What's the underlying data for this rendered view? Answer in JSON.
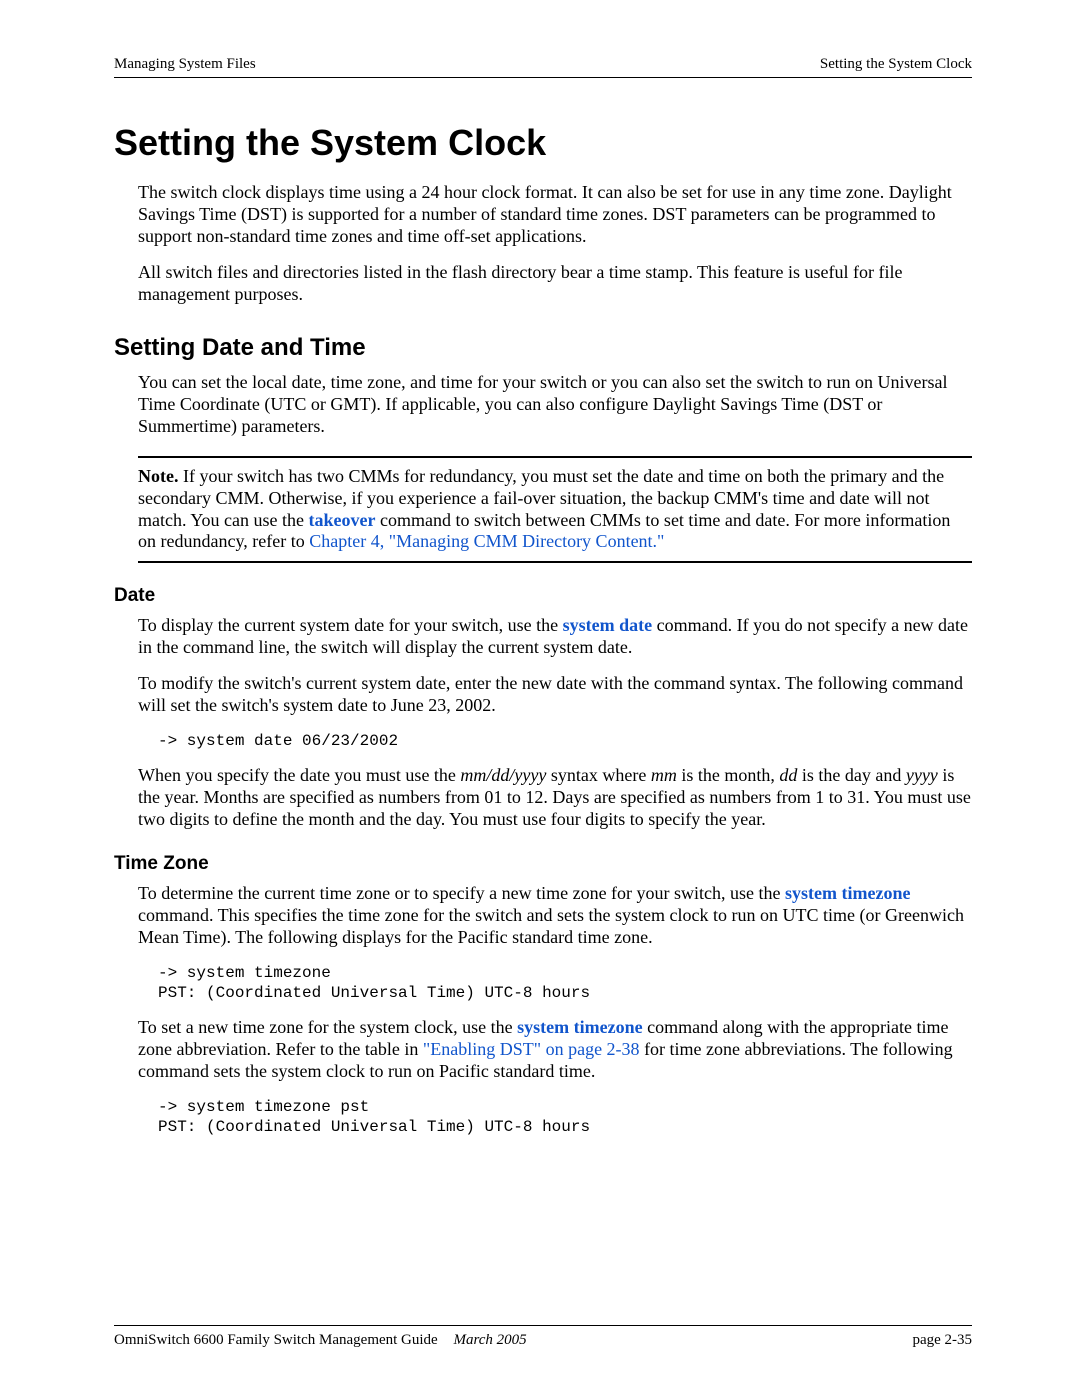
{
  "header": {
    "left": "Managing System Files",
    "right": "Setting the System Clock"
  },
  "title": "Setting the System Clock",
  "intro_p1": "The switch clock displays time using a 24 hour clock format. It can also be set for use in any time zone. Daylight Savings Time (DST) is supported for a number of standard time zones. DST parameters can be programmed to support non-standard time zones and time off-set applications.",
  "intro_p2": "All switch files and directories listed in the flash directory bear a time stamp. This feature is useful for file management purposes.",
  "s1_heading": "Setting Date and Time",
  "s1_p1": "You can set the local date, time zone, and time for your switch or you can also set the switch to run on Universal Time Coordinate (UTC or GMT). If applicable, you can also configure Daylight Savings Time (DST or Summertime) parameters.",
  "note": {
    "label": "Note.",
    "text_before_takeover": " If your switch has two CMMs for redundancy, you must set the date and time on both the primary and the secondary CMM. Otherwise, if you experience a fail-over situation, the backup CMM's time and date will not match. You can use the ",
    "takeover": "takeover",
    "text_after_takeover": " command to switch between CMMs to set time and date. For more information on redundancy, refer to ",
    "chapter_link": "Chapter 4, \"Managing CMM Directory Content.\""
  },
  "date": {
    "heading": "Date",
    "p1_a": "To display the current system date for your switch, use the ",
    "p1_link": "system date",
    "p1_b": " command. If you do not specify a new date in the command line, the switch will display the current system date.",
    "p2": "To modify the switch's current system date, enter the new date with the command syntax. The following command will set the switch's system date to June 23, 2002.",
    "code1": "-> system date 06/23/2002",
    "p3_a": "When you specify the date you must use the ",
    "p3_i1": "mm/dd/yyyy",
    "p3_b": " syntax where ",
    "p3_i2": "mm",
    "p3_c": " is the month, ",
    "p3_i3": "dd",
    "p3_d": " is the day and ",
    "p3_i4": "yyyy",
    "p3_e": " is the year. Months are specified as numbers from 01 to 12. Days are specified as numbers from 1 to 31. You must use two digits to define the month and the day. You must use four digits to specify the year."
  },
  "tz": {
    "heading": "Time Zone",
    "p1_a": "To determine the current time zone or to specify a new time zone for your switch, use the ",
    "p1_link": "system timezone",
    "p1_b": " command. This specifies the time zone for the switch and sets the system clock to run on UTC time (or Greenwich Mean Time). The following displays for the Pacific standard time zone.",
    "code1": "-> system timezone\nPST: (Coordinated Universal Time) UTC-8 hours",
    "p2_a": "To set a new time zone for the system clock, use the ",
    "p2_link1": "system timezone",
    "p2_b": " command along with the appropriate time zone abbreviation. Refer to the table in ",
    "p2_link2": "\"Enabling DST\" on page 2-38",
    "p2_c": " for time zone abbreviations. The following command sets the system clock to run on Pacific standard time.",
    "code2": "-> system timezone pst\nPST: (Coordinated Universal Time) UTC-8 hours"
  },
  "footer": {
    "guide": "OmniSwitch 6600 Family Switch Management Guide",
    "date": "March 2005",
    "page": "page 2-35"
  }
}
